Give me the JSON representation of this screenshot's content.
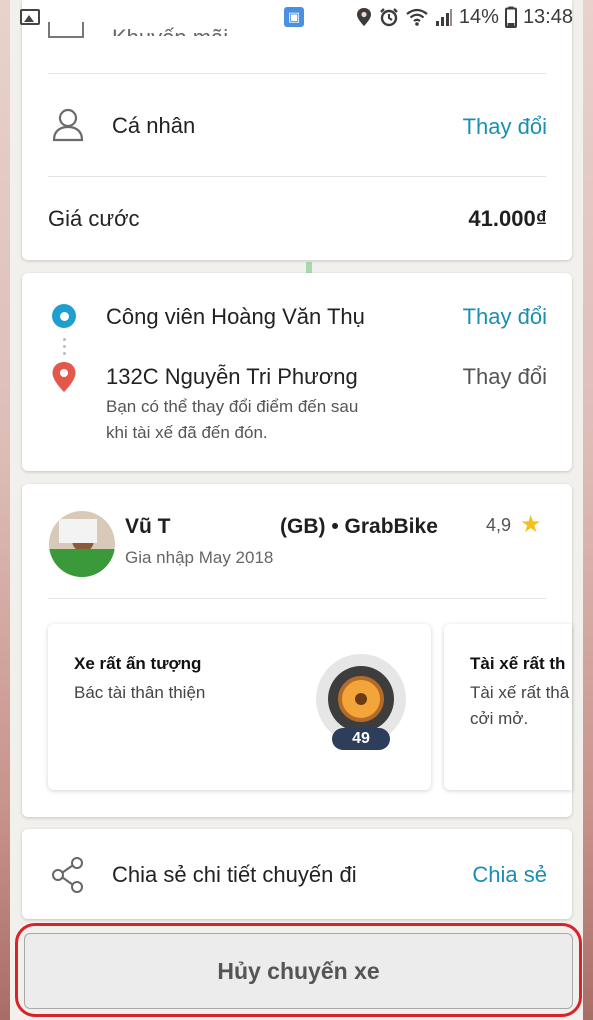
{
  "status_bar": {
    "battery": "14%",
    "time": "13:48",
    "bus_glyph": "▣"
  },
  "icons": {
    "person": "person-outline-icon",
    "pickup": "pickup-dot-icon",
    "destination": "location-pin-icon",
    "star": "star-icon",
    "share": "share-icon",
    "wheel": "wheel-badge-icon"
  },
  "colors": {
    "link": "#1a8fb2",
    "pickup": "#1f9fcf",
    "destination": "#e4574b",
    "star": "#f4bf1f",
    "cancel_outline": "#d8232a"
  },
  "trip_options": {
    "top_partial_label": "Khuyến mãi",
    "profile_label": "Cá nhân",
    "profile_action": "Thay đổi",
    "fare_label": "Giá cước",
    "fare_value": "41.000₫"
  },
  "route": {
    "pickup": "Công viên Hoàng Văn Thụ",
    "pickup_action": "Thay đổi",
    "destination": "132C Nguyễn Tri Phương",
    "destination_action": "Thay đổi",
    "note_line1": "Bạn có thể thay đổi điểm đến sau",
    "note_line2": "khi tài xế đã đến đón."
  },
  "driver": {
    "name_start": "Vũ T",
    "name_end": "(GB) • GrabBike",
    "rating": "4,9",
    "joined": "Gia nhập May 2018",
    "star_glyph": "★"
  },
  "compliments": [
    {
      "title": "Xe rất ấn tượng",
      "desc_line1": "Bác tài thân thiện",
      "desc_line2": "",
      "count": "49"
    },
    {
      "title": "Tài xế rất th",
      "desc_line1": "Tài xế rất thâ",
      "desc_line2": "cởi mở."
    }
  ],
  "share": {
    "label": "Chia sẻ chi tiết chuyến đi",
    "action": "Chia sẻ"
  },
  "cancel": {
    "label": "Hủy chuyến xe"
  }
}
